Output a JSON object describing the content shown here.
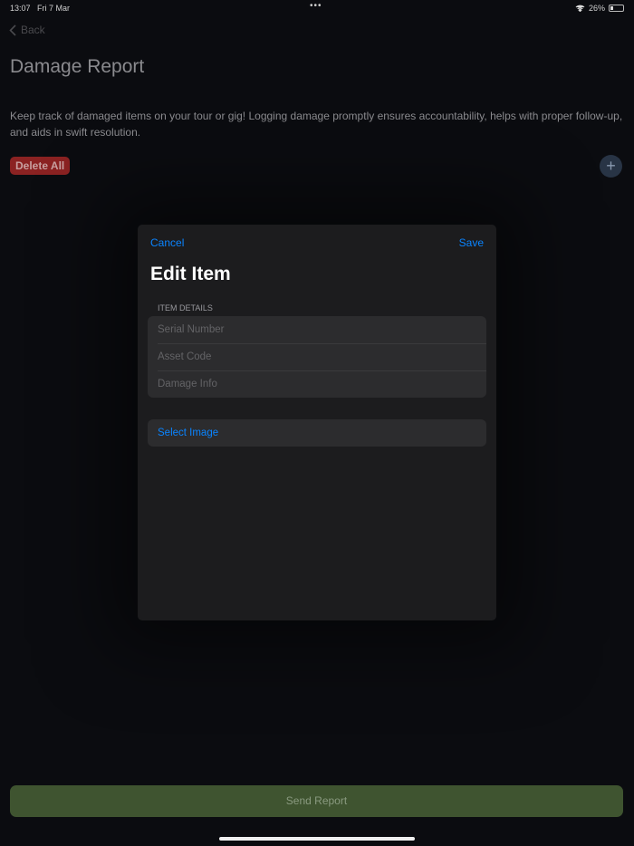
{
  "status": {
    "time": "13:07",
    "date": "Fri 7 Mar",
    "battery": "26%"
  },
  "nav": {
    "back": "Back"
  },
  "page": {
    "title": "Damage Report",
    "description": "Keep track of damaged items on your tour or gig! Logging damage promptly ensures accountability, helps with proper follow-up, and aids in swift resolution.",
    "delete_all": "Delete All",
    "send_report": "Send Report"
  },
  "modal": {
    "cancel": "Cancel",
    "save": "Save",
    "title": "Edit Item",
    "section": "ITEM DETAILS",
    "fields": [
      {
        "placeholder": "Serial Number"
      },
      {
        "placeholder": "Asset Code"
      },
      {
        "placeholder": "Damage Info"
      }
    ],
    "select_image": "Select Image"
  }
}
